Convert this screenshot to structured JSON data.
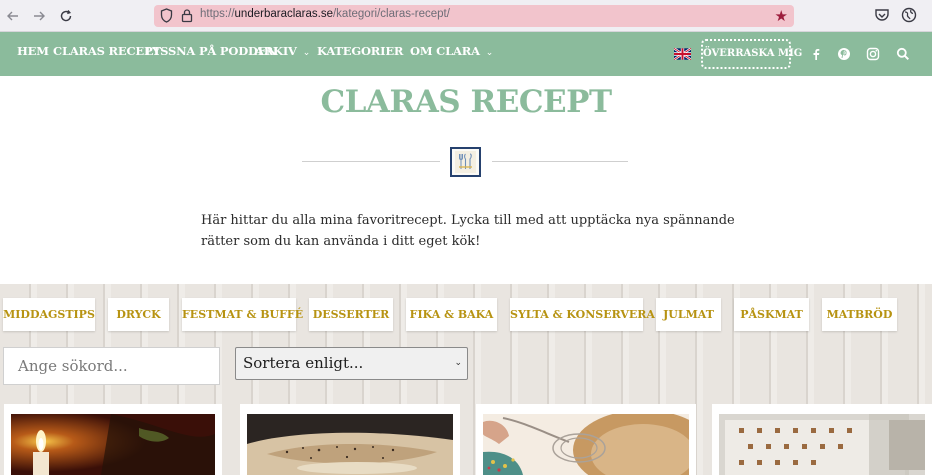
{
  "browser": {
    "back_icon": "arrow-left-icon",
    "forward_icon": "arrow-right-icon",
    "reload_icon": "reload-icon",
    "url_prefix": "https://",
    "url_domain": "underbaraclaras.se",
    "url_path": "/kategori/claras-recept/",
    "bookmark_icon": "star-icon",
    "pocket_icon": "pocket-icon",
    "extension_icon": "globe-icon"
  },
  "nav": {
    "items": [
      {
        "label": "HEM",
        "has_dropdown": false
      },
      {
        "label": "CLARAS RECEPT",
        "has_dropdown": false
      },
      {
        "label": "LYSSNA PÅ PODDEN",
        "has_dropdown": false
      },
      {
        "label": "ARKIV",
        "has_dropdown": true
      },
      {
        "label": "KATEGORIER",
        "has_dropdown": true
      },
      {
        "label": "OM CLARA",
        "has_dropdown": true
      }
    ],
    "chevron": "⌄",
    "language_flag": "uk-flag-icon",
    "surprise_label": "ÖVERRASKA MIG",
    "social_icons": [
      "facebook-icon",
      "pinterest-icon",
      "instagram-icon",
      "search-icon"
    ]
  },
  "header": {
    "title": "CLARAS RECEPT",
    "intro": "Här hittar du alla mina favoritrecept. Lycka till med att upptäcka nya spännande rätter som du kan använda i ditt eget kök!"
  },
  "categories": [
    "MIDDAGSTIPS",
    "DRYCK",
    "FESTMAT & BUFFÉ",
    "DESSERTER",
    "FIKA & BAKA",
    "SYLTA & KONSERVERA",
    "JULMAT",
    "PÅSKMAT",
    "MATBRÖD"
  ],
  "search": {
    "placeholder": "Ange sökord...",
    "sort_selected": "Sortera enligt..."
  },
  "colors": {
    "brand_green": "#8bbb9c",
    "category_gold": "#b79312",
    "emblem_navy": "#26416e",
    "url_highlight": "#f2c4cc"
  }
}
